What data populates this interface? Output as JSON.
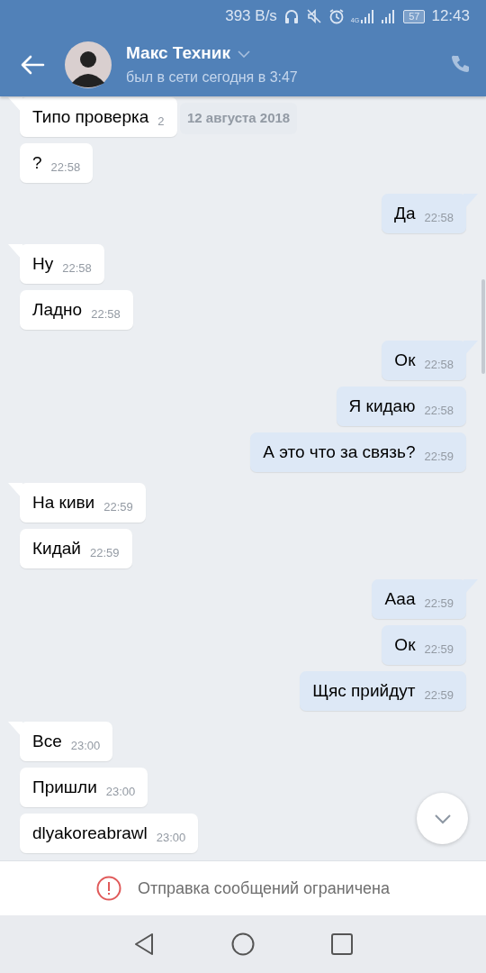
{
  "status_bar": {
    "speed": "393 B/s",
    "network": "4G",
    "battery": "57",
    "time": "12:43"
  },
  "header": {
    "name": "Макс Техник",
    "status": "был в сети сегодня в 3:47"
  },
  "date_pill": "12 августа 2018",
  "groups": [
    {
      "kind": "incoming",
      "messages": [
        {
          "text": "Типо проверка",
          "time": "2"
        },
        {
          "text": "?",
          "time": "22:58"
        }
      ]
    },
    {
      "kind": "outgoing",
      "messages": [
        {
          "text": "Да",
          "time": "22:58"
        }
      ]
    },
    {
      "kind": "incoming",
      "messages": [
        {
          "text": "Ну",
          "time": "22:58"
        },
        {
          "text": "Ладно",
          "time": "22:58"
        }
      ]
    },
    {
      "kind": "outgoing",
      "messages": [
        {
          "text": "Ок",
          "time": "22:58"
        },
        {
          "text": "Я кидаю",
          "time": "22:58"
        },
        {
          "text": "А это что за связь?",
          "time": "22:59"
        }
      ]
    },
    {
      "kind": "incoming",
      "messages": [
        {
          "text": "На киви",
          "time": "22:59"
        },
        {
          "text": "Кидай",
          "time": "22:59"
        }
      ]
    },
    {
      "kind": "outgoing",
      "messages": [
        {
          "text": "Ааа",
          "time": "22:59"
        },
        {
          "text": "Ок",
          "time": "22:59"
        },
        {
          "text": "Щяс прийдут",
          "time": "22:59"
        }
      ]
    },
    {
      "kind": "incoming",
      "messages": [
        {
          "text": "Все",
          "time": "23:00"
        },
        {
          "text": "Пришли",
          "time": "23:00"
        },
        {
          "text": "dlyakoreabrawl",
          "time": "23:00"
        }
      ]
    }
  ],
  "notice": "Отправка сообщений ограничена"
}
